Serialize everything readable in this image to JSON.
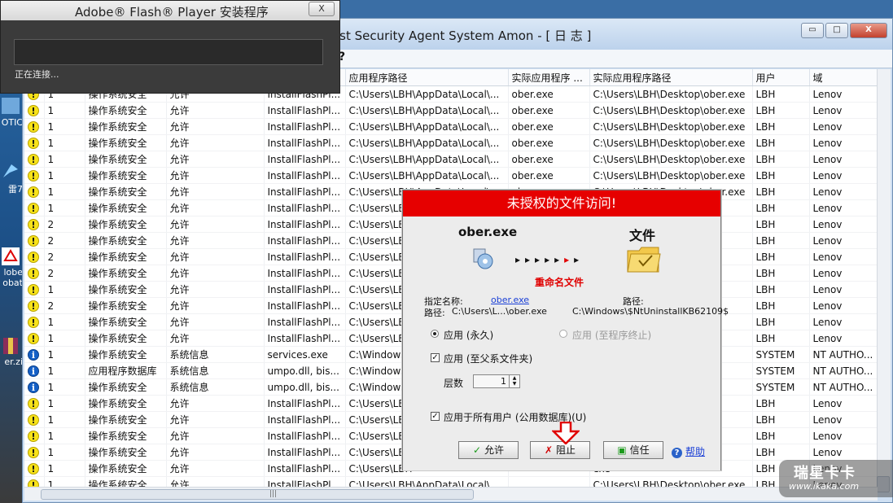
{
  "flash_window": {
    "title": "Adobe® Flash® Player 安装程序",
    "close_label": "X",
    "status": "正在连接..."
  },
  "desktop": {
    "labels": [
      "OTIC",
      "雷7",
      "lobe",
      "obat",
      "er.zi"
    ]
  },
  "main_window": {
    "title": "ost Security Agent System Amon - [ 日 志 ]",
    "toolbar_help": "?",
    "buttons": {
      "minimize": "▭",
      "maximize": "□",
      "close": "X"
    }
  },
  "table": {
    "columns": [
      "应用程序路径",
      "实际应用程序 ...",
      "实际应用程序路径",
      "用户",
      "域"
    ],
    "rows": [
      {
        "icon": "warn",
        "n": "1",
        "cat": "操作系统安全",
        "res": "允许",
        "app": "InstallFlashPl...",
        "path": "C:\\Users\\LBH\\AppData\\Local\\...",
        "real": "ober.exe",
        "rpath": "C:\\Users\\LBH\\Desktop\\ober.exe",
        "user": "LBH",
        "domain": "Lenov"
      },
      {
        "icon": "warn",
        "n": "1",
        "cat": "操作系统安全",
        "res": "允许",
        "app": "InstallFlashPl...",
        "path": "C:\\Users\\LBH\\AppData\\Local\\...",
        "real": "ober.exe",
        "rpath": "C:\\Users\\LBH\\Desktop\\ober.exe",
        "user": "LBH",
        "domain": "Lenov"
      },
      {
        "icon": "warn",
        "n": "1",
        "cat": "操作系统安全",
        "res": "允许",
        "app": "InstallFlashPl...",
        "path": "C:\\Users\\LBH\\AppData\\Local\\...",
        "real": "ober.exe",
        "rpath": "C:\\Users\\LBH\\Desktop\\ober.exe",
        "user": "LBH",
        "domain": "Lenov"
      },
      {
        "icon": "warn",
        "n": "1",
        "cat": "操作系统安全",
        "res": "允许",
        "app": "InstallFlashPl...",
        "path": "C:\\Users\\LBH\\AppData\\Local\\...",
        "real": "ober.exe",
        "rpath": "C:\\Users\\LBH\\Desktop\\ober.exe",
        "user": "LBH",
        "domain": "Lenov"
      },
      {
        "icon": "warn",
        "n": "1",
        "cat": "操作系统安全",
        "res": "允许",
        "app": "InstallFlashPl...",
        "path": "C:\\Users\\LBH\\AppData\\Local\\...",
        "real": "ober.exe",
        "rpath": "C:\\Users\\LBH\\Desktop\\ober.exe",
        "user": "LBH",
        "domain": "Lenov"
      },
      {
        "icon": "warn",
        "n": "1",
        "cat": "操作系统安全",
        "res": "允许",
        "app": "InstallFlashPl...",
        "path": "C:\\Users\\LBH\\AppData\\Local\\...",
        "real": "ober.exe",
        "rpath": "C:\\Users\\LBH\\Desktop\\ober.exe",
        "user": "LBH",
        "domain": "Lenov"
      },
      {
        "icon": "warn",
        "n": "1",
        "cat": "操作系统安全",
        "res": "允许",
        "app": "InstallFlashPl...",
        "path": "C:\\Users\\LBH\\AppData\\Local\\...",
        "real": "ober.exe",
        "rpath": "C:\\Users\\LBH\\Desktop\\ober.exe",
        "user": "LBH",
        "domain": "Lenov"
      },
      {
        "icon": "warn",
        "n": "1",
        "cat": "操作系统安全",
        "res": "允许",
        "app": "InstallFlashPl...",
        "path": "C:\\Users\\LBH",
        "real": "",
        "rpath": "ober.exe",
        "user": "LBH",
        "domain": "Lenov"
      },
      {
        "icon": "warn",
        "n": "2",
        "cat": "操作系统安全",
        "res": "允许",
        "app": "InstallFlashPl...",
        "path": "C:\\Users\\LBH",
        "real": "",
        "rpath": "ober.exe",
        "user": "LBH",
        "domain": "Lenov"
      },
      {
        "icon": "warn",
        "n": "2",
        "cat": "操作系统安全",
        "res": "允许",
        "app": "InstallFlashPl...",
        "path": "C:\\Users\\LBH",
        "real": "",
        "rpath": "ober.exe",
        "user": "LBH",
        "domain": "Lenov"
      },
      {
        "icon": "warn",
        "n": "2",
        "cat": "操作系统安全",
        "res": "允许",
        "app": "InstallFlashPl...",
        "path": "C:\\Users\\LBH",
        "real": "",
        "rpath": "ober.exe",
        "user": "LBH",
        "domain": "Lenov"
      },
      {
        "icon": "warn",
        "n": "2",
        "cat": "操作系统安全",
        "res": "允许",
        "app": "InstallFlashPl...",
        "path": "C:\\Users\\LBH",
        "real": "",
        "rpath": "ober.exe",
        "user": "LBH",
        "domain": "Lenov"
      },
      {
        "icon": "warn",
        "n": "1",
        "cat": "操作系统安全",
        "res": "允许",
        "app": "InstallFlashPl...",
        "path": "C:\\Users\\LBH",
        "real": "",
        "rpath": "ober.exe",
        "user": "LBH",
        "domain": "Lenov"
      },
      {
        "icon": "warn",
        "n": "2",
        "cat": "操作系统安全",
        "res": "允许",
        "app": "InstallFlashPl...",
        "path": "C:\\Users\\LBH",
        "real": "",
        "rpath": "ober.exe",
        "user": "LBH",
        "domain": "Lenov"
      },
      {
        "icon": "warn",
        "n": "1",
        "cat": "操作系统安全",
        "res": "允许",
        "app": "InstallFlashPl...",
        "path": "C:\\Users\\LBH",
        "real": "",
        "rpath": "ober.exe",
        "user": "LBH",
        "domain": "Lenov"
      },
      {
        "icon": "warn",
        "n": "1",
        "cat": "操作系统安全",
        "res": "允许",
        "app": "InstallFlashPl...",
        "path": "C:\\Users\\LBH",
        "real": "",
        "rpath": "ober.exe",
        "user": "LBH",
        "domain": "Lenov"
      },
      {
        "icon": "info",
        "n": "1",
        "cat": "操作系统安全",
        "res": "系统信息",
        "app": "services.exe",
        "path": "C:\\Windows",
        "real": "",
        "rpath": "ice...",
        "user": "SYSTEM",
        "domain": "NT AUTHO..."
      },
      {
        "icon": "info",
        "n": "1",
        "cat": "应用程序数据库",
        "res": "系统信息",
        "app": "umpo.dll, bis...",
        "path": "C:\\Windows",
        "real": "",
        "rpath": "o.d...",
        "user": "SYSTEM",
        "domain": "NT AUTHO..."
      },
      {
        "icon": "info",
        "n": "1",
        "cat": "操作系统安全",
        "res": "系统信息",
        "app": "umpo.dll, bis...",
        "path": "C:\\Windows",
        "real": "",
        "rpath": "o.d...",
        "user": "SYSTEM",
        "domain": "NT AUTHO..."
      },
      {
        "icon": "warn",
        "n": "1",
        "cat": "操作系统安全",
        "res": "允许",
        "app": "InstallFlashPl...",
        "path": "C:\\Users\\LBH",
        "real": "",
        "rpath": "exe",
        "user": "LBH",
        "domain": "Lenov"
      },
      {
        "icon": "warn",
        "n": "1",
        "cat": "操作系统安全",
        "res": "允许",
        "app": "InstallFlashPl...",
        "path": "C:\\Users\\LBH",
        "real": "",
        "rpath": "exe",
        "user": "LBH",
        "domain": "Lenov"
      },
      {
        "icon": "warn",
        "n": "1",
        "cat": "操作系统安全",
        "res": "允许",
        "app": "InstallFlashPl...",
        "path": "C:\\Users\\LBH",
        "real": "",
        "rpath": "exe",
        "user": "LBH",
        "domain": "Lenov"
      },
      {
        "icon": "warn",
        "n": "1",
        "cat": "操作系统安全",
        "res": "允许",
        "app": "InstallFlashPl...",
        "path": "C:\\Users\\LBH",
        "real": "",
        "rpath": "exe",
        "user": "LBH",
        "domain": "Lenov"
      },
      {
        "icon": "warn",
        "n": "1",
        "cat": "操作系统安全",
        "res": "允许",
        "app": "InstallFlashPl...",
        "path": "C:\\Users\\LBH",
        "real": "",
        "rpath": "exe",
        "user": "LBH",
        "domain": "Lenov"
      },
      {
        "icon": "warn",
        "n": "1",
        "cat": "操作系统安全",
        "res": "允许",
        "app": "InstallFlashPl...",
        "path": "C:\\Users\\LBH\\AppData\\Local\\...",
        "real": "",
        "rpath": "C:\\Users\\LBH\\Desktop\\ober.exe",
        "user": "LBH",
        "domain": "Lenov"
      }
    ]
  },
  "dialog": {
    "title": "未授权的文件访问!",
    "source_name": "ober.exe",
    "target_type": "文件",
    "arrows_black": "▸▸▸▸▸",
    "arrow_red": "▸",
    "arrow_end": "▸",
    "action": "重命名文件",
    "specified_name_label": "指定名称:",
    "specified_name_value": "ober.exe",
    "path_label": "路径:",
    "source_path_label": "路径:",
    "source_path_value": "C:\\Users\\L...\\ober.exe",
    "target_path_value": "C:\\Windows\\$NtUninstallKB62109$",
    "radio_permanent": "应用 (永久)",
    "radio_until_exit": "应用 (至程序终止)",
    "check_parent_folder": "应用 (至父系文件夹)",
    "levels_label": "层数",
    "levels_value": "1",
    "check_all_users": "应用于所有用户 (公用数据库)(U)",
    "btn_allow": "允许",
    "btn_block": "阻止",
    "btn_trust": "信任",
    "btn_help": "帮助"
  },
  "watermark": {
    "brand": "瑞星卡卡",
    "url": "www.ikaka.com"
  },
  "colors": {
    "dialog_header": "#e60000",
    "warning_icon": "#f7e21a",
    "info_icon": "#1560c6"
  }
}
